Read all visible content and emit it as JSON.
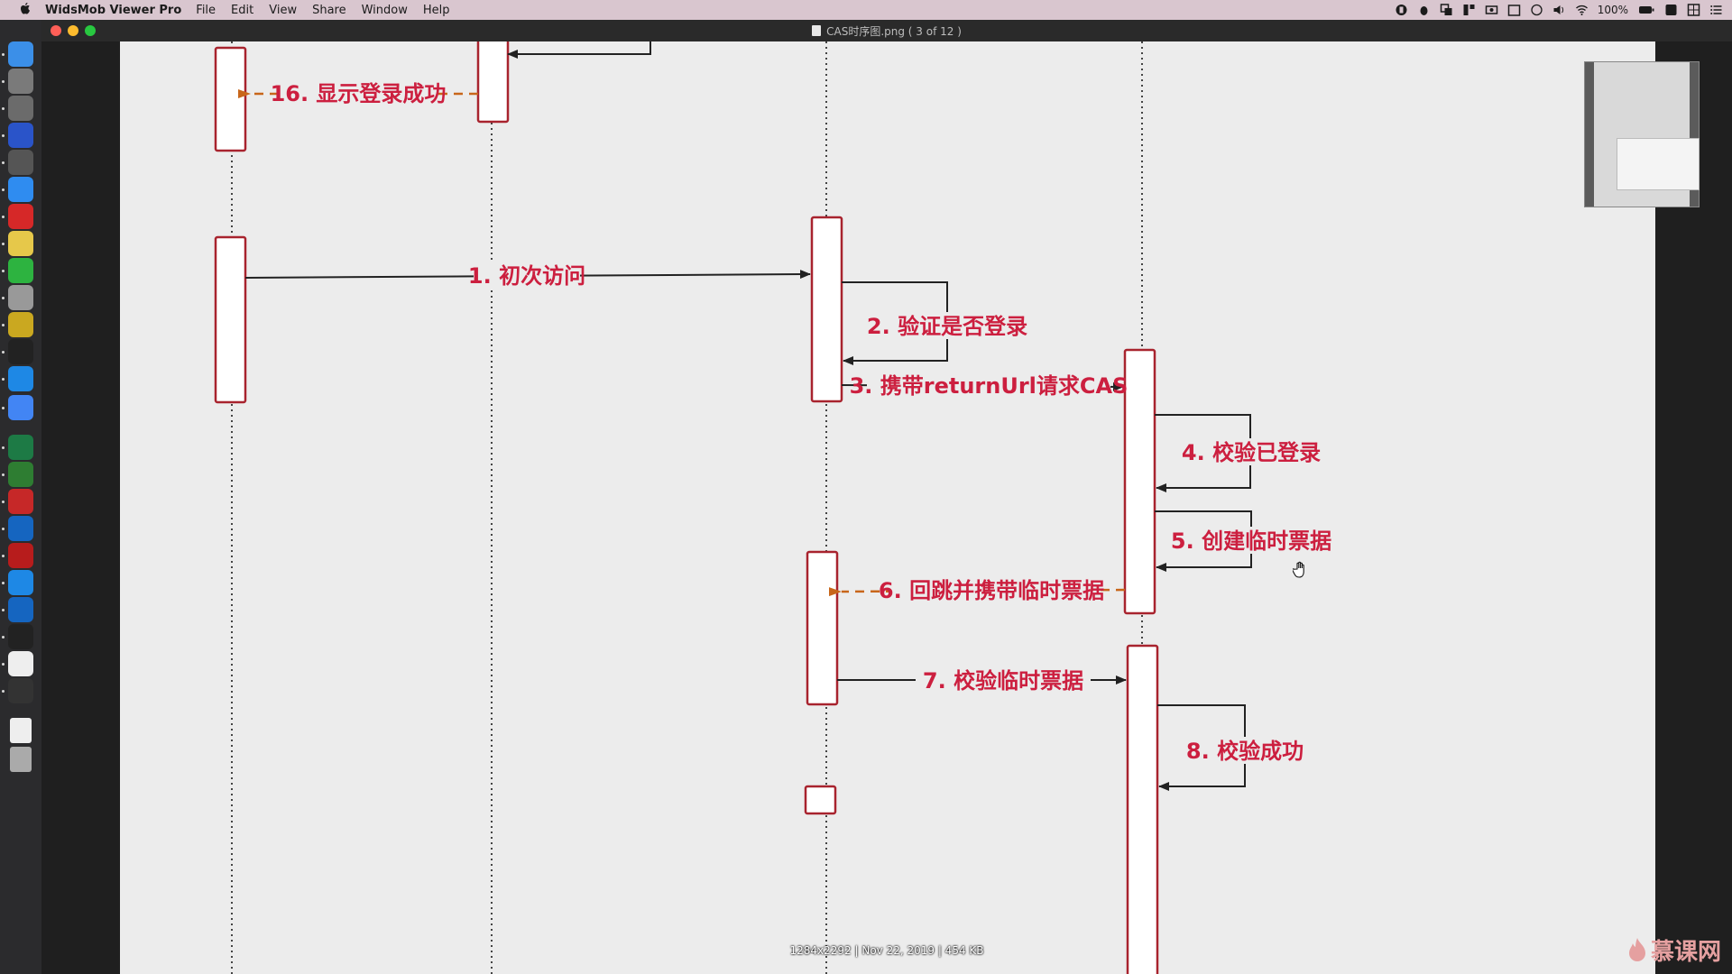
{
  "menubar": {
    "app_name": "WidsMob Viewer Pro",
    "menus": [
      "File",
      "Edit",
      "View",
      "Share",
      "Window",
      "Help"
    ],
    "battery": "100%"
  },
  "window": {
    "title": "CAS时序图.png ( 3 of 12 )",
    "image_info": "1284x2292 | Nov 22, 2019 | 454 KB"
  },
  "diagram": {
    "messages": {
      "m16": "16. 显示登录成功",
      "m1": "1. 初次访问",
      "m2": "2. 验证是否登录",
      "m3": "3. 携带returnUrl请求CAS",
      "m4": "4. 校验已登录",
      "m5": "5. 创建临时票据",
      "m6": "6. 回跳并携带临时票据",
      "m7": "7. 校验临时票据",
      "m8": "8. 校验成功"
    },
    "colors": {
      "activation_border": "#a8232e",
      "label_text": "#cc1f3f",
      "async_arrow": "#c8661a",
      "solid_arrow": "#222222",
      "lifeline": "#444444"
    }
  },
  "watermark": {
    "text": "慕课网"
  },
  "icons": {
    "apple": "apple-icon",
    "dock": [
      "finder-icon",
      "launchpad-icon",
      "system-preferences-icon",
      "intellij-icon",
      "activity-monitor-icon",
      "app-store-icon",
      "postal-icon",
      "stickies-icon",
      "evernote-icon",
      "game-icon",
      "ultraedit-icon",
      "terminal-icon",
      "vscode-icon",
      "chrome-icon",
      "excel-icon",
      "navicat-icon",
      "hbuilder-icon",
      "screen-icon",
      "remote-desktop-icon",
      "migration-icon",
      "word-icon",
      "player-icon",
      "keka-icon",
      "viewer-icon",
      "document-icon",
      "trash-icon"
    ]
  }
}
